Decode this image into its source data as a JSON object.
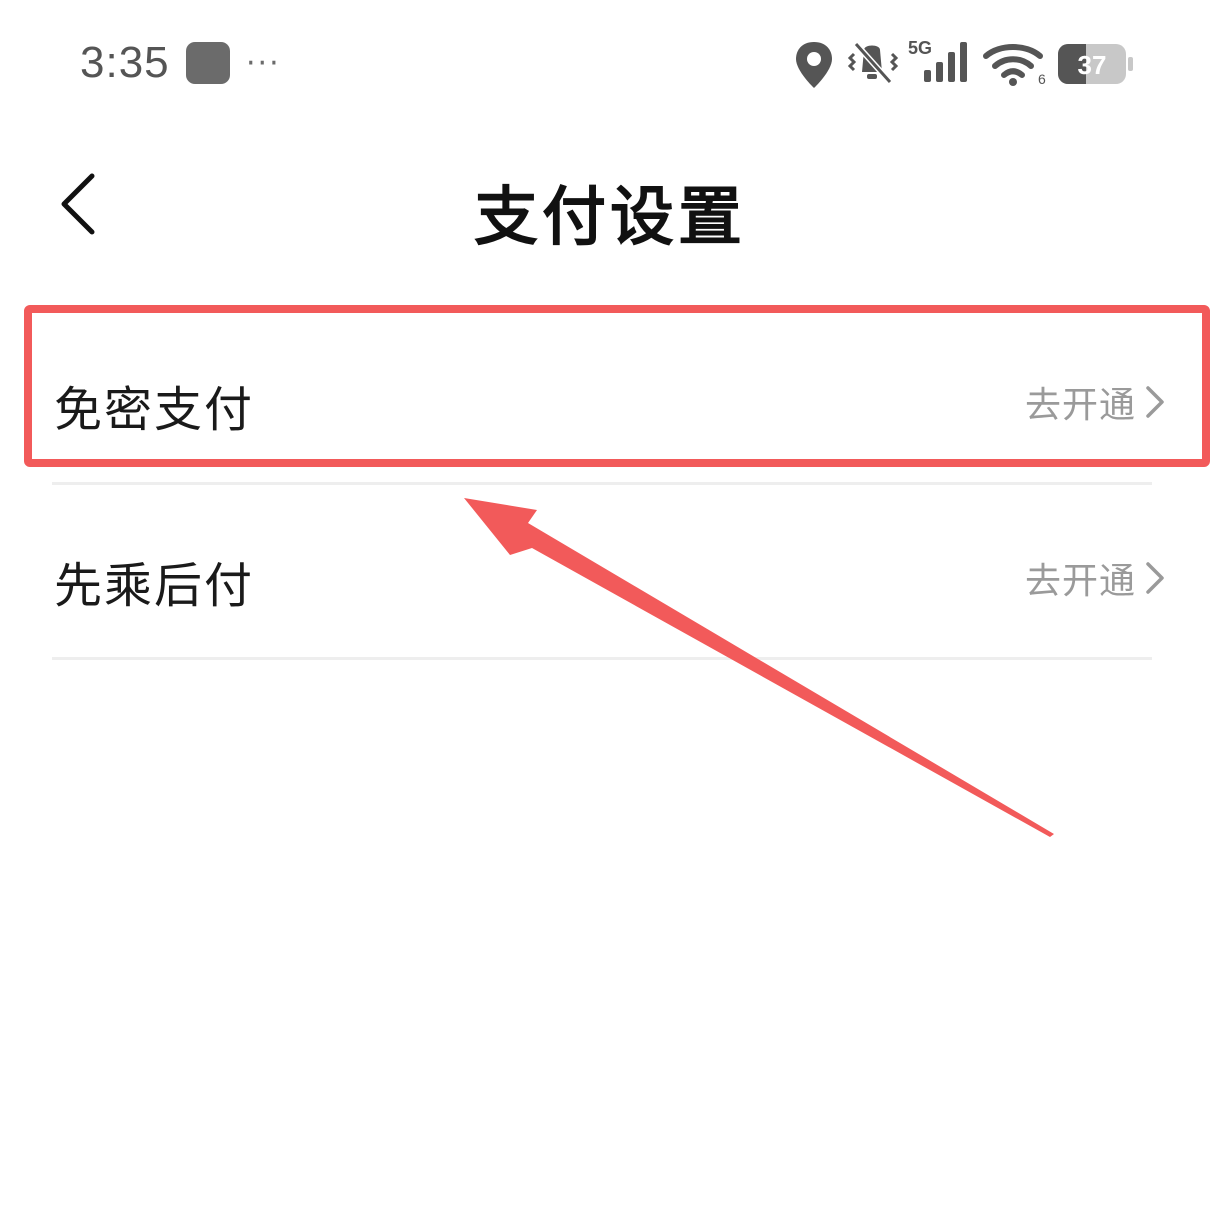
{
  "status_bar": {
    "time": "3:35",
    "dots": "···",
    "network": "5G",
    "wifi_badge": "6",
    "battery": "37"
  },
  "header": {
    "title": "支付设置"
  },
  "settings": {
    "items": [
      {
        "label": "免密支付",
        "action": "去开通"
      },
      {
        "label": "先乘后付",
        "action": "去开通"
      }
    ]
  },
  "annotation": {
    "color": "#f25a5a"
  }
}
